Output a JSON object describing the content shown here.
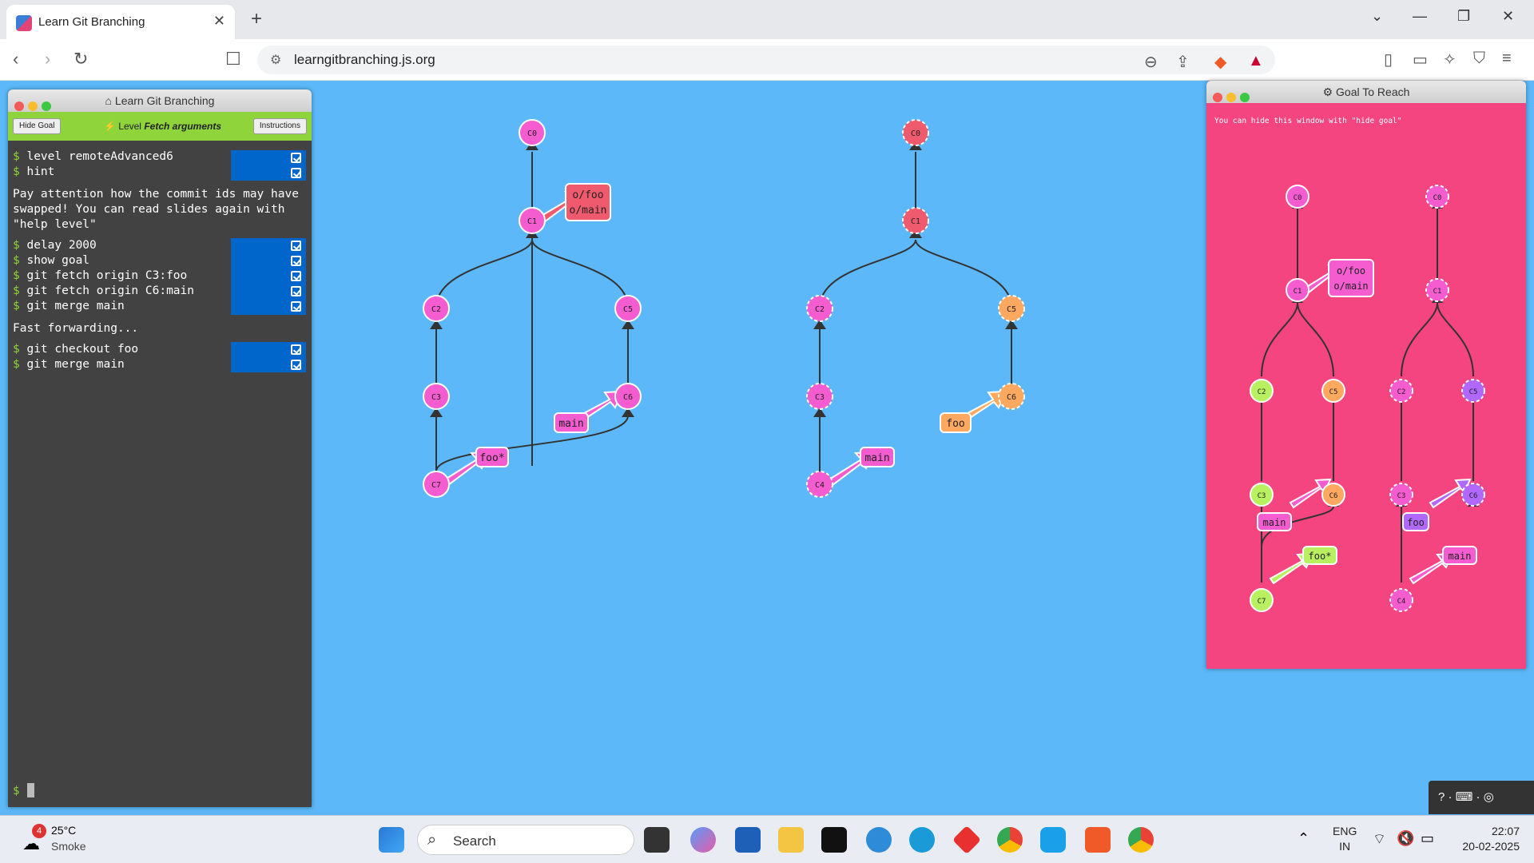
{
  "browser": {
    "tab_title": "Learn Git Branching",
    "url": "learngitbranching.js.org",
    "new_tab": "+",
    "close_tab": "✕"
  },
  "terminal": {
    "window_title": "Learn Git Branching",
    "hide_goal": "Hide Goal",
    "level_label": "Level",
    "level_name": "Fetch arguments",
    "instructions": "Instructions",
    "commands": [
      {
        "text": "level remoteAdvanced6"
      },
      {
        "text": "hint"
      },
      {
        "text": "delay 2000"
      },
      {
        "text": "show goal"
      },
      {
        "text": "git fetch origin C3:foo"
      },
      {
        "text": "git fetch origin C6:main"
      },
      {
        "text": "git merge main"
      },
      {
        "text": "git checkout foo"
      },
      {
        "text": "git merge main"
      }
    ],
    "hint_message": "Pay attention how the commit ids may have swapped! You can read slides again with \"help level\"",
    "fast_forward_message": "Fast forwarding...",
    "prompt": "$"
  },
  "local_tree": {
    "nodes": [
      "C0",
      "C1",
      "C2",
      "C5",
      "C3",
      "C6",
      "C7"
    ],
    "labels": {
      "remote": "o/foo",
      "remote2": "o/main",
      "main": "main",
      "foo": "foo*"
    }
  },
  "remote_tree": {
    "nodes": [
      "C0",
      "C1",
      "C2",
      "C5",
      "C3",
      "C6",
      "C4"
    ],
    "labels": {
      "foo": "foo",
      "main": "main"
    }
  },
  "goal": {
    "window_title": "Goal To Reach",
    "hint": "You can hide this window with \"hide goal\"",
    "local_nodes": [
      "C0",
      "C1",
      "C2",
      "C5",
      "C3",
      "C6",
      "C7"
    ],
    "local_labels": {
      "remote": "o/foo",
      "remote2": "o/main",
      "main": "main",
      "foo": "foo*"
    },
    "remote_nodes": [
      "C0",
      "C1",
      "C2",
      "C5",
      "C3",
      "C6",
      "C4"
    ],
    "remote_labels": {
      "foo": "foo",
      "main": "main"
    }
  },
  "taskbar": {
    "weather_temp": "25°C",
    "weather_desc": "Smoke",
    "weather_badge": "4",
    "search_placeholder": "Search",
    "lang_top": "ENG",
    "lang_bottom": "IN",
    "time": "22:07",
    "date": "20-02-2025"
  },
  "colors": {
    "page_bg": "#5cb8f8",
    "node_pink": "#f55cd0",
    "node_red": "#f05a6e",
    "node_orange": "#ffa860",
    "node_green": "#b8f060",
    "node_purple": "#b068ff",
    "goal_bg": "#f44580"
  }
}
